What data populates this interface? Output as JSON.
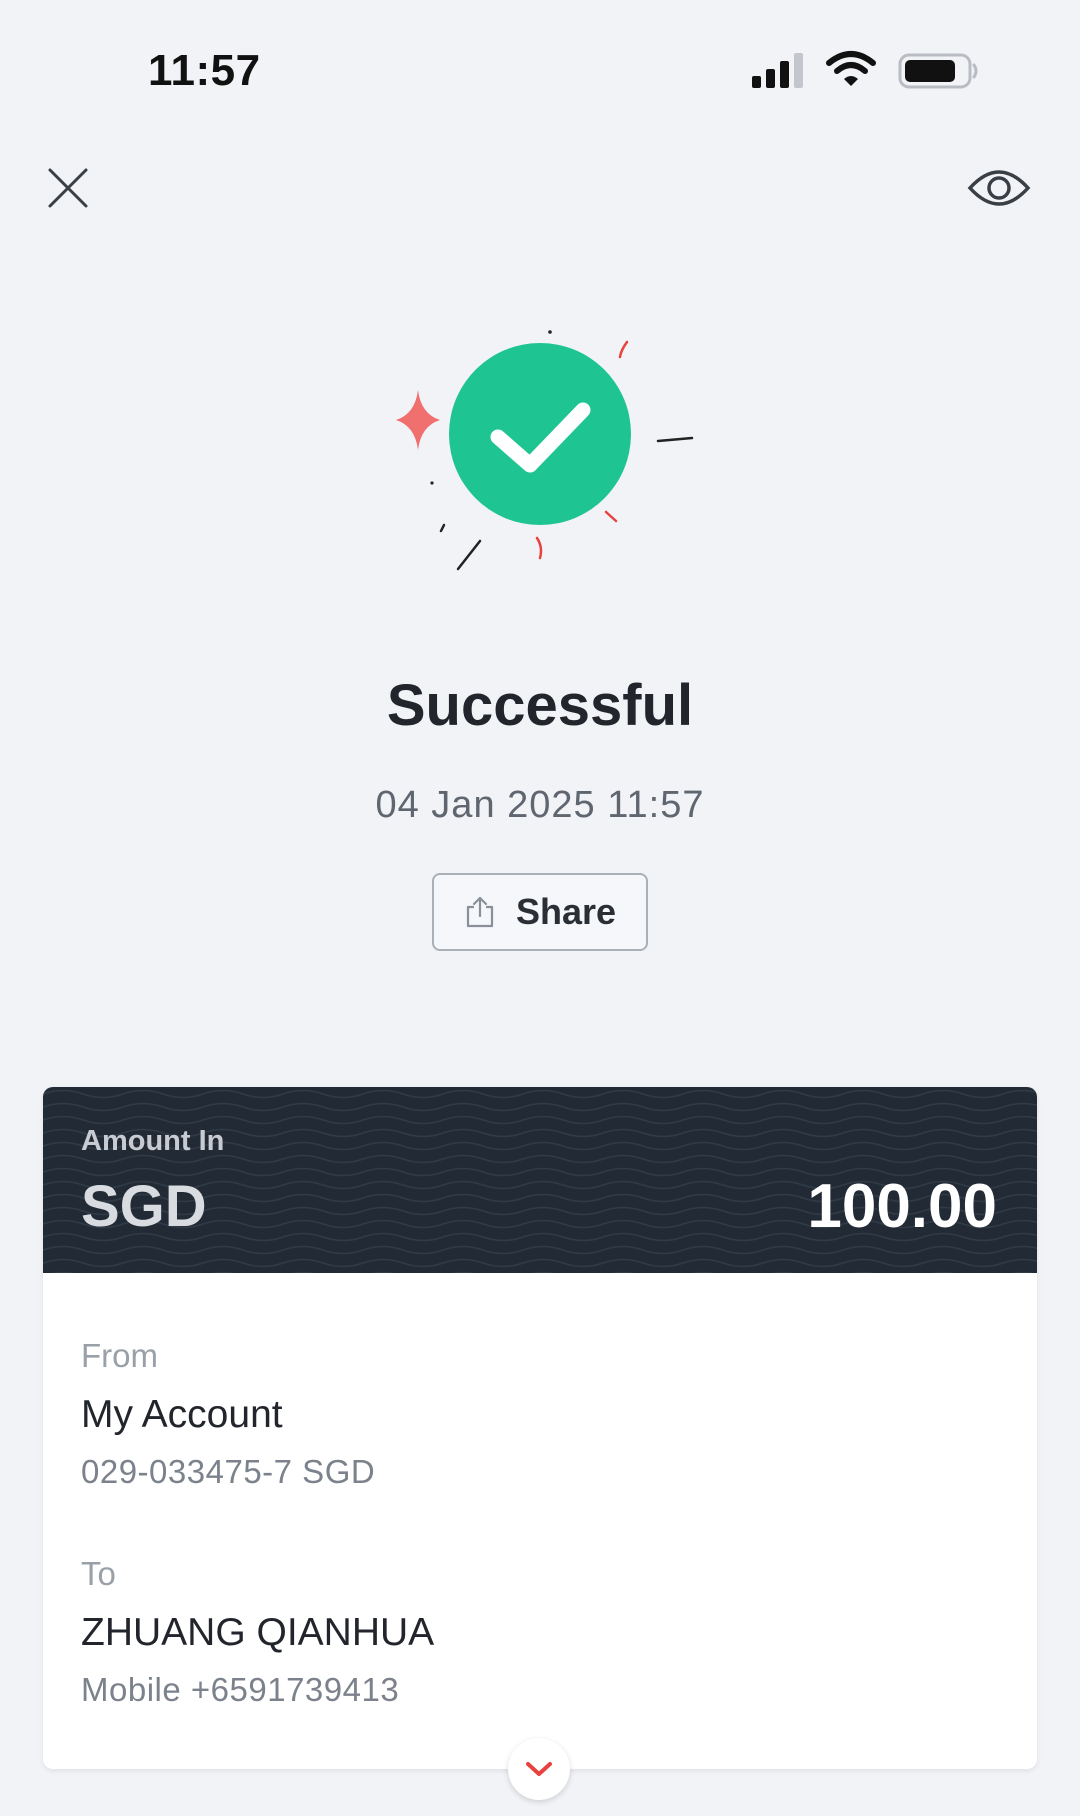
{
  "status_bar": {
    "time": "11:57",
    "icons": [
      "cellular-signal-icon",
      "wifi-icon",
      "battery-icon"
    ]
  },
  "header": {
    "close_icon": "close-icon",
    "visibility_icon": "eye-icon"
  },
  "result": {
    "icon": "check-circle-icon",
    "title": "Successful",
    "timestamp": "04 Jan 2025 11:57",
    "share_label": "Share",
    "share_icon": "share-icon"
  },
  "amount": {
    "label": "Amount In",
    "currency": "SGD",
    "value": "100.00"
  },
  "from": {
    "label": "From",
    "name": "My Account",
    "account": "029-033475-7 SGD"
  },
  "to": {
    "label": "To",
    "name": "ZHUANG QIANHUA",
    "detail": "Mobile +6591739413"
  },
  "expand_icon": "chevron-down-icon",
  "colors": {
    "background": "#f1f3f7",
    "success_green": "#1ec592",
    "accent_red": "#e8423f",
    "sparkle_pink": "#f07070",
    "amount_header_bg": "#222b35",
    "card_bg": "#ffffff"
  }
}
